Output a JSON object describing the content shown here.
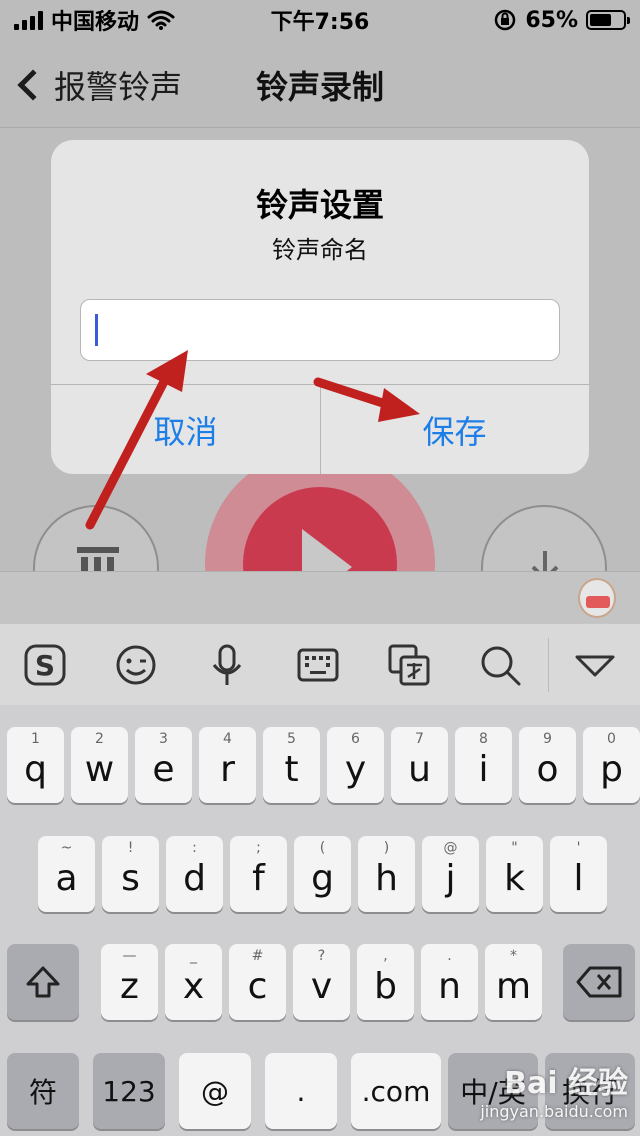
{
  "status": {
    "carrier": "中国移动",
    "time": "下午7:56",
    "battery": "65%",
    "battery_level": 0.65
  },
  "nav": {
    "back_label": "报警铃声",
    "title": "铃声录制"
  },
  "dialog": {
    "title": "铃声设置",
    "message": "铃声命名",
    "input_value": "",
    "cancel_label": "取消",
    "save_label": "保存"
  },
  "colors": {
    "accent": "#1e7ee8",
    "record": "#c93a4f",
    "annotation_arrow": "#c0201e"
  },
  "keyboard": {
    "row1": [
      {
        "k": "q",
        "s": "1"
      },
      {
        "k": "w",
        "s": "2"
      },
      {
        "k": "e",
        "s": "3"
      },
      {
        "k": "r",
        "s": "4"
      },
      {
        "k": "t",
        "s": "5"
      },
      {
        "k": "y",
        "s": "6"
      },
      {
        "k": "u",
        "s": "7"
      },
      {
        "k": "i",
        "s": "8"
      },
      {
        "k": "o",
        "s": "9"
      },
      {
        "k": "p",
        "s": "0"
      }
    ],
    "row2": [
      {
        "k": "a",
        "s": "~"
      },
      {
        "k": "s",
        "s": "!"
      },
      {
        "k": "d",
        "s": ":"
      },
      {
        "k": "f",
        "s": ";"
      },
      {
        "k": "g",
        "s": "("
      },
      {
        "k": "h",
        "s": ")"
      },
      {
        "k": "j",
        "s": "@"
      },
      {
        "k": "k",
        "s": "\""
      },
      {
        "k": "l",
        "s": "'"
      }
    ],
    "row3": [
      {
        "k": "z",
        "s": "—"
      },
      {
        "k": "x",
        "s": "_"
      },
      {
        "k": "c",
        "s": "#"
      },
      {
        "k": "v",
        "s": "?"
      },
      {
        "k": "b",
        "s": ","
      },
      {
        "k": "n",
        "s": "."
      },
      {
        "k": "m",
        "s": "*"
      }
    ],
    "bottom": {
      "symbol": "符",
      "num": "123",
      "at": "@",
      "dot": ".",
      "com": ".com",
      "lang": "中/英",
      "enter": "换行"
    }
  },
  "watermark": {
    "site": "jingyan.baidu.com",
    "brand": "Bai 经验"
  }
}
